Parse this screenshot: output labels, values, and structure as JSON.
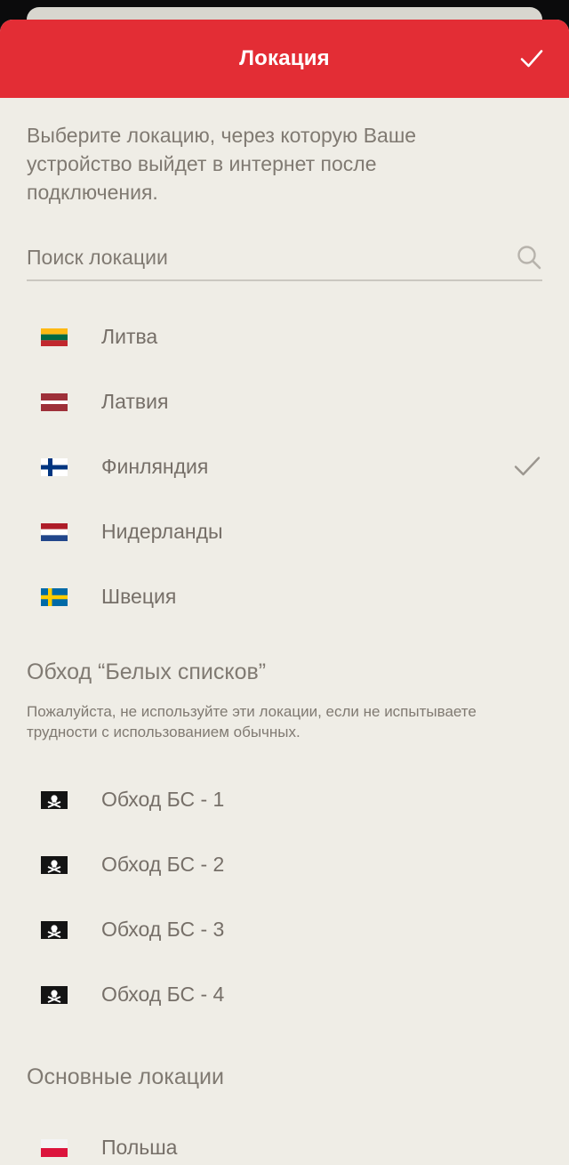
{
  "header": {
    "title": "Локация",
    "confirm_icon": "checkmark-icon",
    "background": "#e32d35"
  },
  "description": "Выберите локацию, через которую Ваше устройство выйдет в интернет после подключения.",
  "search": {
    "placeholder": "Поиск локации",
    "value": "",
    "icon": "search-icon"
  },
  "locations": [
    {
      "name": "Литва",
      "flag": "lithuania-flag-icon",
      "selected": false
    },
    {
      "name": "Латвия",
      "flag": "latvia-flag-icon",
      "selected": false
    },
    {
      "name": "Финляндия",
      "flag": "finland-flag-icon",
      "selected": true
    },
    {
      "name": "Нидерланды",
      "flag": "netherlands-flag-icon",
      "selected": false
    },
    {
      "name": "Швеция",
      "flag": "sweden-flag-icon",
      "selected": false
    }
  ],
  "bypass_section": {
    "title": "Обход “Белых списков”",
    "note": "Пожалуйста, не используйте эти локации, если не испытываете трудности с использованием обычных.",
    "items": [
      {
        "name": "Обход БС - 1",
        "flag": "pirate-flag-icon"
      },
      {
        "name": "Обход БС - 2",
        "flag": "pirate-flag-icon"
      },
      {
        "name": "Обход БС - 3",
        "flag": "pirate-flag-icon"
      },
      {
        "name": "Обход БС - 4",
        "flag": "pirate-flag-icon"
      }
    ]
  },
  "main_section": {
    "title": "Основные локации",
    "items": [
      {
        "name": "Польша",
        "flag": "poland-flag-icon"
      }
    ]
  }
}
